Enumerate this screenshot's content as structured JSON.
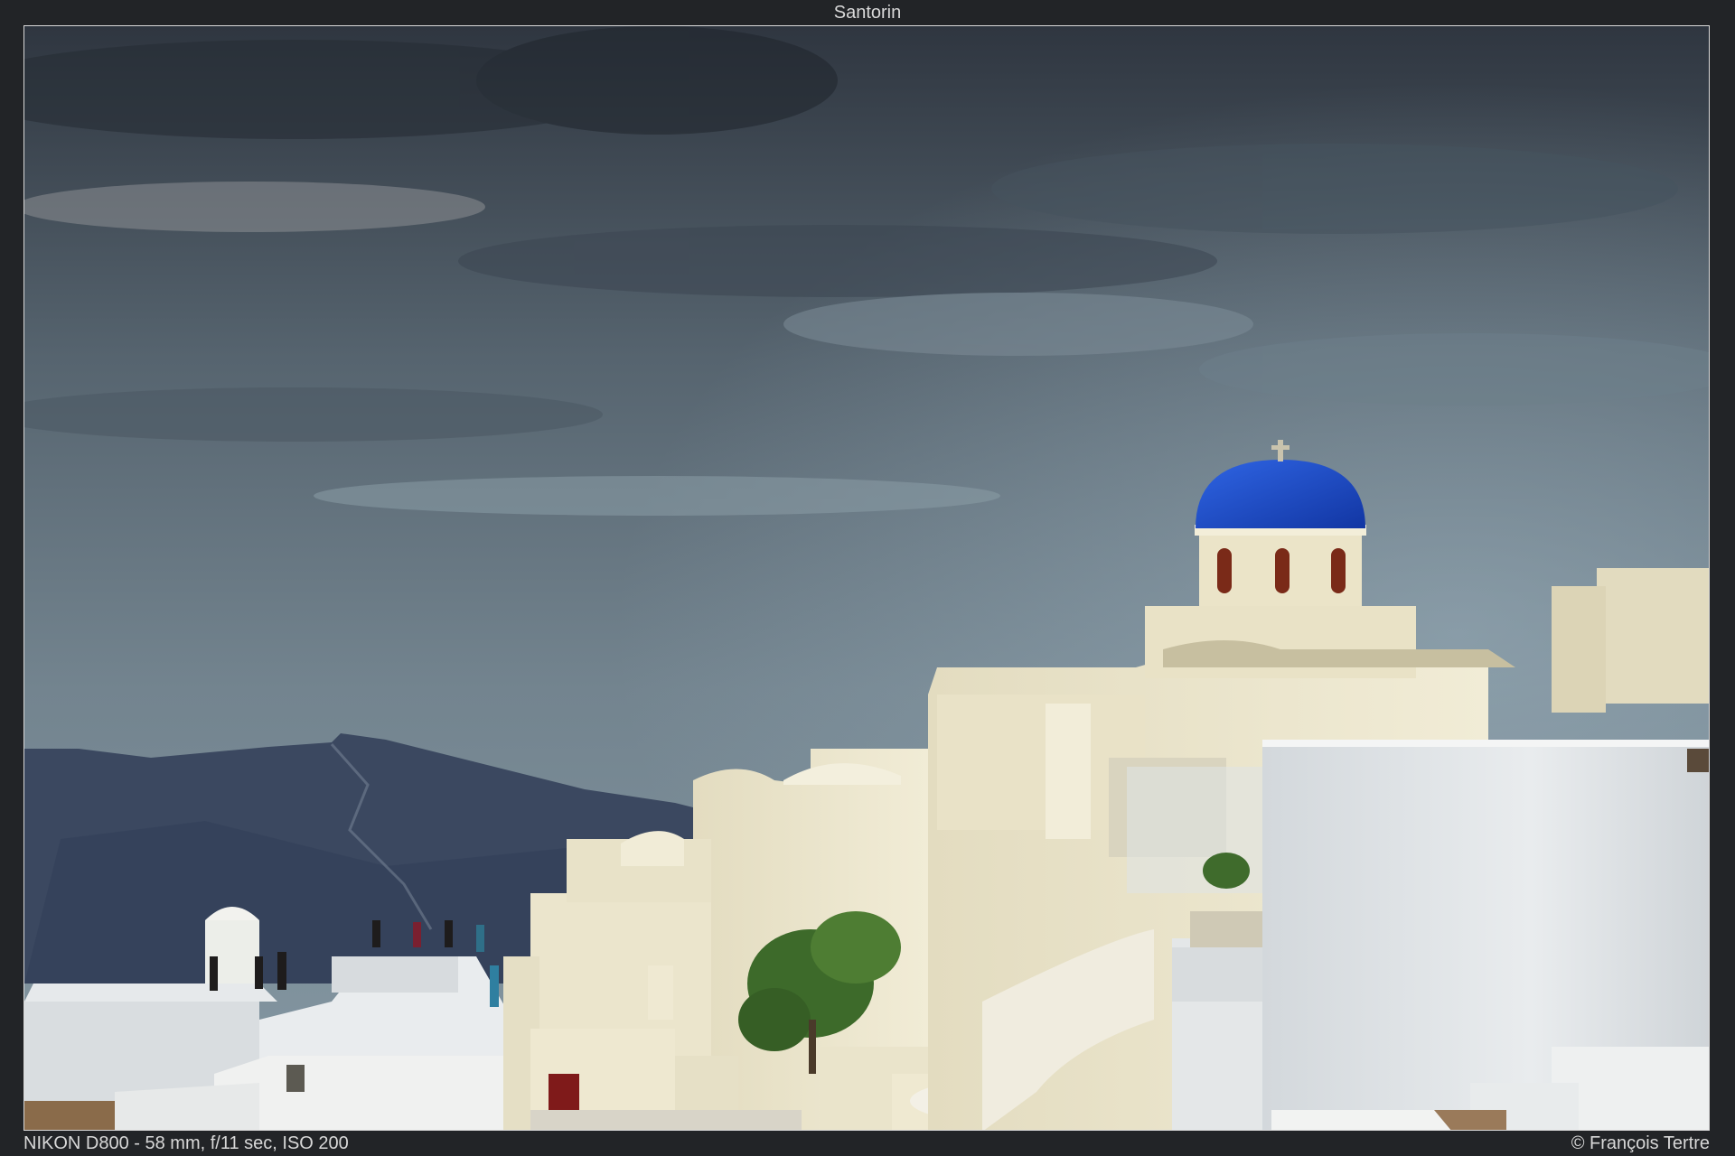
{
  "title": "Santorin",
  "exif": "NIKON D800 - 58 mm, f/11 sec, ISO 200",
  "copyright": "© François Tertre",
  "photo": {
    "subject": "photograph",
    "colors": {
      "sky_dark": "#2c333d",
      "sky_light": "#7a8c99",
      "mountain": "#3c4a61",
      "dome": "#1a47c4",
      "buildings": "#ece7cf",
      "white_wall": "#dfe3e6",
      "door": "#8a1b1b",
      "foliage": "#3f6b2c"
    }
  }
}
